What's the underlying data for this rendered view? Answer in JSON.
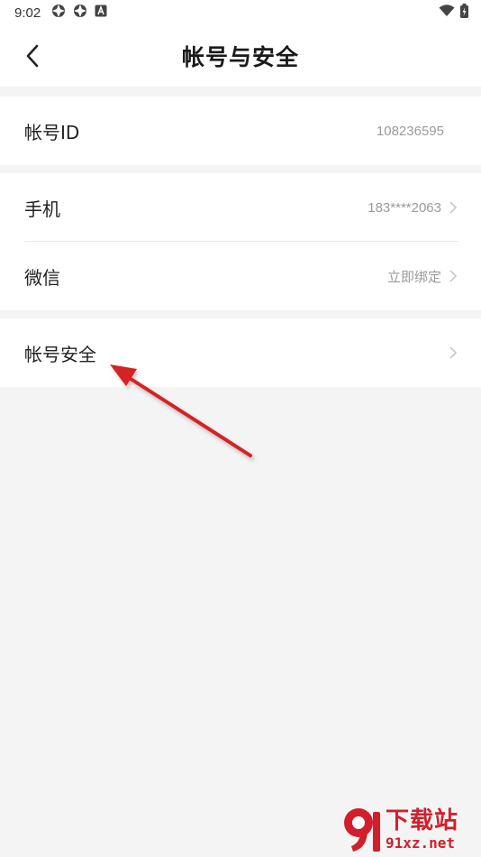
{
  "status_bar": {
    "time": "9:02",
    "icons_left": [
      "app-notification-icon",
      "app-notification-icon",
      "keyboard-a-icon"
    ],
    "icons_right": [
      "wifi-icon",
      "battery-charging-icon"
    ]
  },
  "header": {
    "title": "帐号与安全",
    "back_icon": "chevron-left-icon"
  },
  "account_group": {
    "id_label": "帐号ID",
    "id_value": "108236595"
  },
  "binding_group": {
    "phone_label": "手机",
    "phone_value": "183****2063",
    "wechat_label": "微信",
    "wechat_value": "立即绑定"
  },
  "security_group": {
    "security_label": "帐号安全"
  },
  "annotation": {
    "arrow_color": "#d62424"
  },
  "watermark": {
    "title": "下载站",
    "url": "91xz.net",
    "color": "#d21f2c"
  }
}
